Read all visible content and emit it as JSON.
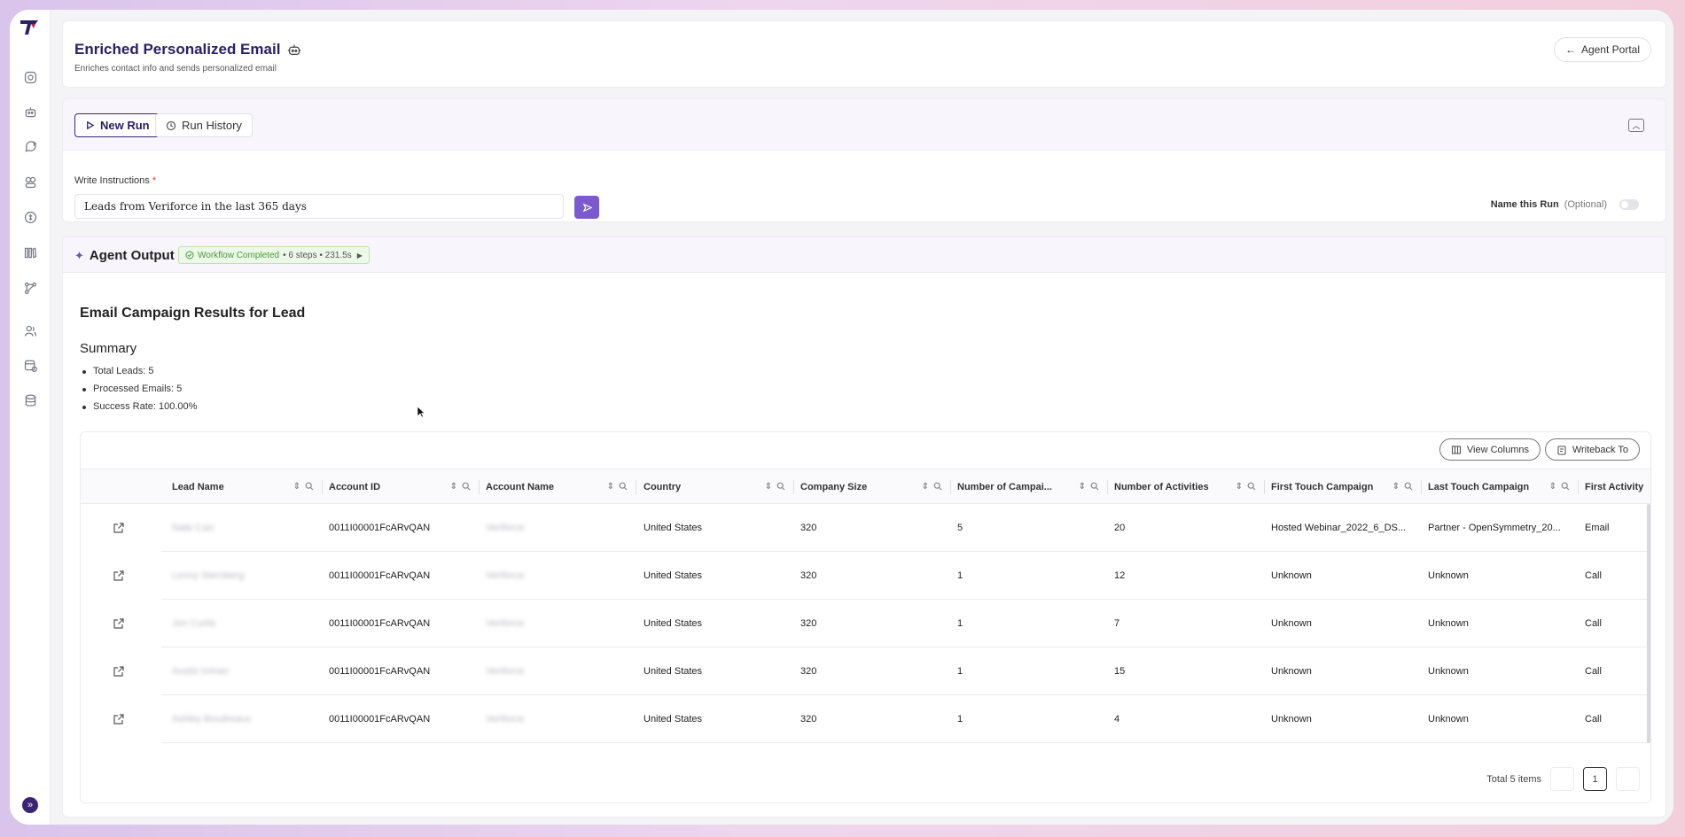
{
  "header": {
    "title": "Enriched Personalized Email",
    "subtitle": "Enriches contact info and sends personalized email",
    "portal_label": "Agent Portal"
  },
  "run": {
    "new_run_label": "New Run",
    "run_history_label": "Run History",
    "instructions_label": "Write Instructions",
    "required_mark": "*",
    "instructions_value": "Leads from Veriforce in the last 365 days",
    "name_run_label": "Name this Run",
    "name_run_optional": "(Optional)"
  },
  "output": {
    "title": "Agent Output",
    "badge_status": "Workflow Completed",
    "badge_meta": "• 6 steps • 231.5s",
    "results_title": "Email Campaign Results for Lead",
    "summary_title": "Summary",
    "summary_items": [
      "Total Leads: 5",
      "Processed Emails: 5",
      "Success Rate: 100.00%"
    ]
  },
  "table": {
    "view_columns_label": "View Columns",
    "writeback_label": "Writeback To",
    "columns": [
      "Lead Name",
      "Account ID",
      "Account Name",
      "Country",
      "Company Size",
      "Number of Campai...",
      "Number of Activities",
      "First Touch Campaign",
      "Last Touch Campaign",
      "First Activity"
    ],
    "rows": [
      [
        "Nate Carr",
        "0011I00001FcARvQAN",
        "Veriforce",
        "United States",
        "320",
        "5",
        "20",
        "Hosted Webinar_2022_6_DS...",
        "Partner - OpenSymmetry_20...",
        "Email"
      ],
      [
        "Lenny Sternberg",
        "0011I00001FcARvQAN",
        "Veriforce",
        "United States",
        "320",
        "1",
        "12",
        "Unknown",
        "Unknown",
        "Call"
      ],
      [
        "Jon Curtis",
        "0011I00001FcARvQAN",
        "Veriforce",
        "United States",
        "320",
        "1",
        "7",
        "Unknown",
        "Unknown",
        "Call"
      ],
      [
        "Austin Inman",
        "0011I00001FcARvQAN",
        "Veriforce",
        "United States",
        "320",
        "1",
        "15",
        "Unknown",
        "Unknown",
        "Call"
      ],
      [
        "Ashley Boudreaux",
        "0011I00001FcARvQAN",
        "Veriforce",
        "United States",
        "320",
        "1",
        "4",
        "Unknown",
        "Unknown",
        "Call"
      ]
    ],
    "total_label": "Total 5 items",
    "current_page": "1"
  },
  "colors": {
    "brand": "#2a2160",
    "accent": "#7b5ad0",
    "success": "#4a9a3a"
  },
  "icons": [
    "logo-icon",
    "instagram-icon",
    "robot-icon",
    "chat-sparkle-icon",
    "team-icon",
    "coin-icon",
    "library-icon",
    "workflow-icon",
    "users-icon",
    "calendar-gear-icon",
    "database-icon",
    "expand-icon"
  ]
}
